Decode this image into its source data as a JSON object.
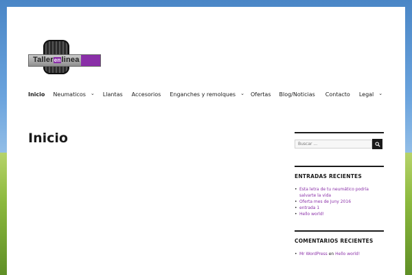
{
  "site": {
    "logo_text": {
      "part1": "Taller",
      "part2": "en",
      "part3": "linea"
    },
    "colors": {
      "accent": "#8a2fa8",
      "text": "#1a1a1a"
    }
  },
  "nav": {
    "items": [
      {
        "label": "Inicio",
        "dropdown": false
      },
      {
        "label": "Neumaticos",
        "dropdown": true
      },
      {
        "label": "Llantas",
        "dropdown": false
      },
      {
        "label": "Accesorios",
        "dropdown": false
      },
      {
        "label": "Enganches y remolques",
        "dropdown": true
      },
      {
        "label": "Ofertas",
        "dropdown": false
      },
      {
        "label": "Blog/Noticias",
        "dropdown": false
      },
      {
        "label": "Contacto",
        "dropdown": false
      },
      {
        "label": "Legal",
        "dropdown": true
      }
    ]
  },
  "main": {
    "title": "Inicio"
  },
  "sidebar": {
    "search": {
      "placeholder": "Buscar ...",
      "button_icon": "search-icon"
    },
    "recent_posts": {
      "title": "ENTRADAS RECIENTES",
      "items": [
        "Esta letra de tu neumático podría salvarte la vida",
        "Oferta mes de Juny 2016",
        "entrada 1",
        "Hello world!"
      ]
    },
    "recent_comments": {
      "title": "COMENTARIOS RECIENTES",
      "items": [
        {
          "author": "Mr WordPress",
          "connector": "en",
          "post": "Hello world!"
        }
      ]
    }
  }
}
